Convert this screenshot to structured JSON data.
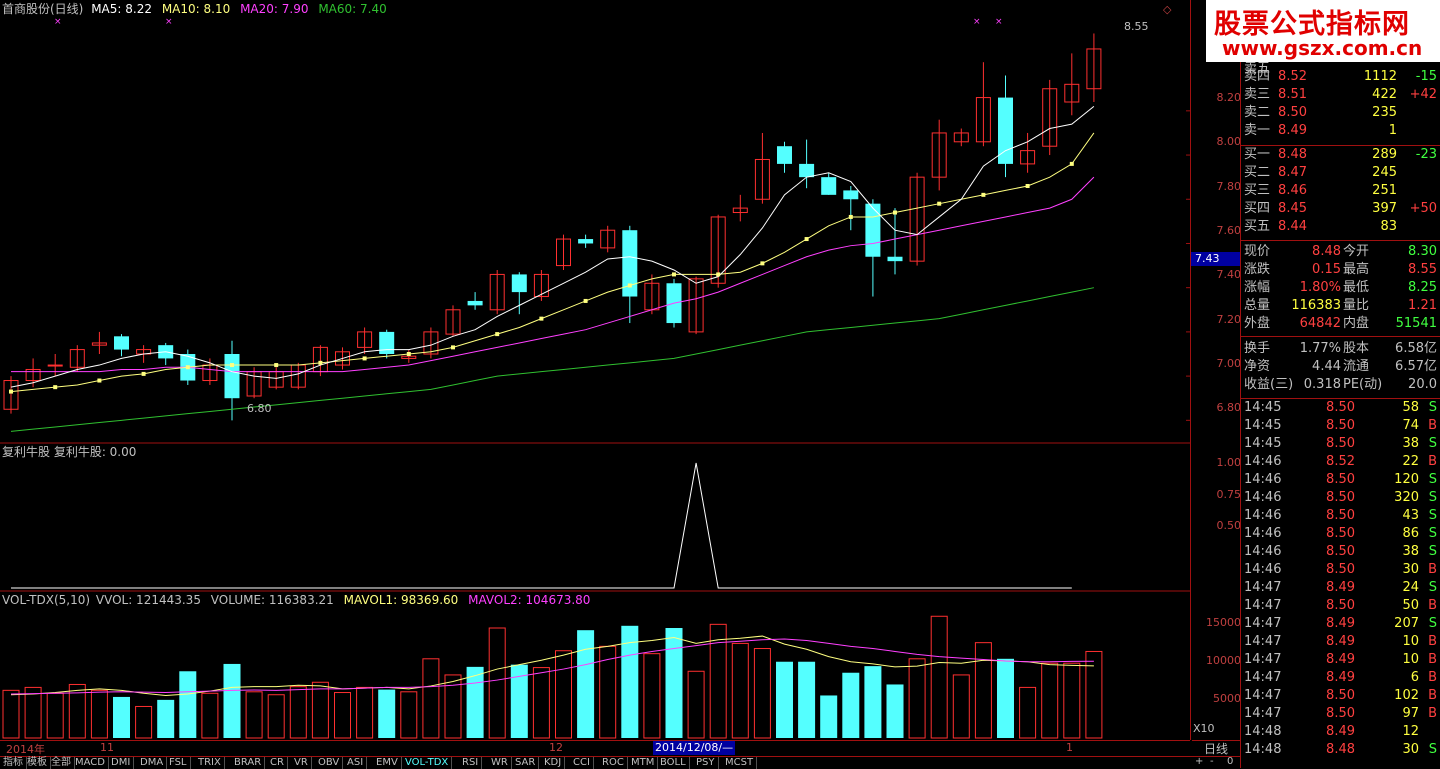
{
  "header": {
    "stock": "首商股份(日线)",
    "ma5": "MA5: 8.22",
    "ma10": "MA10: 8.10",
    "ma20": "MA20: 7.90",
    "ma60": "MA60: 7.40"
  },
  "colors": {
    "up": "#ff3030",
    "down": "#54ffff",
    "ma5": "#ffffff",
    "ma10": "#ffff80",
    "ma20": "#ff40ff",
    "ma60": "#30c030",
    "grid": "#a01010"
  },
  "price_axis": {
    "ticks": [
      "8.20",
      "8.00",
      "7.80",
      "7.60",
      "7.40",
      "7.20",
      "7.00",
      "6.80"
    ],
    "current": "7.43"
  },
  "annotations": {
    "high": "8.55",
    "low": "6.80"
  },
  "indicator": {
    "title": "复利牛股  复利牛股: 0.00",
    "ticks": [
      "1.00",
      "0.75",
      "0.50"
    ],
    "values": [
      0,
      0,
      0,
      0,
      0,
      0,
      0,
      0,
      0,
      0,
      0,
      0,
      0,
      0,
      0,
      0,
      0,
      0,
      0,
      0,
      0,
      0,
      0,
      0,
      0,
      0,
      0,
      0,
      0,
      0,
      0,
      1,
      0,
      0,
      0,
      0,
      0,
      0,
      0,
      0,
      0,
      0,
      0,
      0,
      0,
      0,
      0,
      0,
      0
    ]
  },
  "volume": {
    "title": "VOL-TDX(5,10)",
    "vvol": "VVOL: 121443.35",
    "vol": "VOLUME: 116383.21",
    "mavol1": "MAVOL1: 98369.60",
    "mavol2": "MAVOL2: 104673.80",
    "ticks": [
      "15000",
      "10000",
      "5000"
    ],
    "unit": "X10"
  },
  "time_axis": {
    "labels": [
      "2014年",
      "11",
      "12",
      "1"
    ],
    "cursor": "2014/12/08/—",
    "period": "日线"
  },
  "chart_data": {
    "type": "candlestick",
    "ylim": [
      6.72,
      8.62
    ],
    "vol_ylim": [
      0,
      18000
    ],
    "candles": [
      {
        "o": 6.85,
        "c": 6.98,
        "h": 7.0,
        "l": 6.83,
        "v": 6500
      },
      {
        "o": 6.98,
        "c": 7.03,
        "h": 7.08,
        "l": 6.95,
        "v": 6900
      },
      {
        "o": 7.05,
        "c": 7.05,
        "h": 7.1,
        "l": 7.0,
        "v": 6100
      },
      {
        "o": 7.04,
        "c": 7.12,
        "h": 7.14,
        "l": 7.02,
        "v": 7300
      },
      {
        "o": 7.14,
        "c": 7.15,
        "h": 7.2,
        "l": 7.1,
        "v": 6500
      },
      {
        "o": 7.18,
        "c": 7.12,
        "h": 7.19,
        "l": 7.09,
        "v": 5600
      },
      {
        "o": 7.1,
        "c": 7.12,
        "h": 7.14,
        "l": 7.06,
        "v": 4300
      },
      {
        "o": 7.14,
        "c": 7.08,
        "h": 7.15,
        "l": 7.05,
        "v": 5200
      },
      {
        "o": 7.1,
        "c": 6.98,
        "h": 7.12,
        "l": 6.96,
        "v": 9100
      },
      {
        "o": 6.98,
        "c": 7.05,
        "h": 7.08,
        "l": 6.96,
        "v": 6100
      },
      {
        "o": 7.1,
        "c": 6.9,
        "h": 7.16,
        "l": 6.8,
        "v": 10100
      },
      {
        "o": 6.91,
        "c": 7.02,
        "h": 7.04,
        "l": 6.9,
        "v": 6300
      },
      {
        "o": 6.95,
        "c": 7.02,
        "h": 7.04,
        "l": 6.94,
        "v": 5900
      },
      {
        "o": 6.95,
        "c": 7.05,
        "h": 7.06,
        "l": 6.94,
        "v": 7000
      },
      {
        "o": 7.02,
        "c": 7.13,
        "h": 7.14,
        "l": 7.0,
        "v": 7600
      },
      {
        "o": 7.05,
        "c": 7.11,
        "h": 7.13,
        "l": 7.03,
        "v": 6200
      },
      {
        "o": 7.13,
        "c": 7.2,
        "h": 7.22,
        "l": 7.1,
        "v": 6900
      },
      {
        "o": 7.2,
        "c": 7.1,
        "h": 7.21,
        "l": 7.08,
        "v": 6600
      },
      {
        "o": 7.08,
        "c": 7.09,
        "h": 7.12,
        "l": 7.06,
        "v": 6300
      },
      {
        "o": 7.1,
        "c": 7.2,
        "h": 7.22,
        "l": 7.08,
        "v": 10800
      },
      {
        "o": 7.19,
        "c": 7.3,
        "h": 7.32,
        "l": 7.18,
        "v": 8600
      },
      {
        "o": 7.34,
        "c": 7.32,
        "h": 7.38,
        "l": 7.3,
        "v": 9700
      },
      {
        "o": 7.3,
        "c": 7.46,
        "h": 7.48,
        "l": 7.28,
        "v": 15000
      },
      {
        "o": 7.46,
        "c": 7.38,
        "h": 7.47,
        "l": 7.28,
        "v": 10000
      },
      {
        "o": 7.36,
        "c": 7.46,
        "h": 7.48,
        "l": 7.34,
        "v": 9600
      },
      {
        "o": 7.5,
        "c": 7.62,
        "h": 7.64,
        "l": 7.48,
        "v": 11900
      },
      {
        "o": 7.62,
        "c": 7.6,
        "h": 7.64,
        "l": 7.58,
        "v": 14700
      },
      {
        "o": 7.58,
        "c": 7.66,
        "h": 7.68,
        "l": 7.56,
        "v": 12500
      },
      {
        "o": 7.66,
        "c": 7.36,
        "h": 7.68,
        "l": 7.24,
        "v": 15300
      },
      {
        "o": 7.3,
        "c": 7.42,
        "h": 7.46,
        "l": 7.28,
        "v": 11500
      },
      {
        "o": 7.42,
        "c": 7.24,
        "h": 7.44,
        "l": 7.22,
        "v": 15000
      },
      {
        "o": 7.2,
        "c": 7.44,
        "h": 7.45,
        "l": 7.19,
        "v": 9100
      },
      {
        "o": 7.42,
        "c": 7.72,
        "h": 7.73,
        "l": 7.4,
        "v": 15500
      },
      {
        "o": 7.74,
        "c": 7.76,
        "h": 7.82,
        "l": 7.7,
        "v": 12900
      },
      {
        "o": 7.8,
        "c": 7.98,
        "h": 8.1,
        "l": 7.78,
        "v": 12200
      },
      {
        "o": 8.04,
        "c": 7.96,
        "h": 8.06,
        "l": 7.92,
        "v": 10400
      },
      {
        "o": 7.96,
        "c": 7.9,
        "h": 8.07,
        "l": 7.85,
        "v": 10400
      },
      {
        "o": 7.9,
        "c": 7.82,
        "h": 7.92,
        "l": 7.82,
        "v": 5800
      },
      {
        "o": 7.84,
        "c": 7.8,
        "h": 7.86,
        "l": 7.66,
        "v": 8900
      },
      {
        "o": 7.78,
        "c": 7.54,
        "h": 7.8,
        "l": 7.36,
        "v": 9800
      },
      {
        "o": 7.54,
        "c": 7.52,
        "h": 7.76,
        "l": 7.46,
        "v": 7300
      },
      {
        "o": 7.52,
        "c": 7.9,
        "h": 7.92,
        "l": 7.5,
        "v": 10800
      },
      {
        "o": 7.9,
        "c": 8.1,
        "h": 8.16,
        "l": 7.84,
        "v": 16600
      },
      {
        "o": 8.06,
        "c": 8.1,
        "h": 8.12,
        "l": 8.04,
        "v": 8600
      },
      {
        "o": 8.06,
        "c": 8.26,
        "h": 8.42,
        "l": 8.04,
        "v": 13000
      },
      {
        "o": 8.26,
        "c": 7.96,
        "h": 8.36,
        "l": 7.9,
        "v": 10800
      },
      {
        "o": 7.96,
        "c": 8.02,
        "h": 8.1,
        "l": 7.92,
        "v": 6900
      },
      {
        "o": 8.04,
        "c": 8.3,
        "h": 8.34,
        "l": 8.0,
        "v": 10200
      },
      {
        "o": 8.24,
        "c": 8.32,
        "h": 8.46,
        "l": 8.18,
        "v": 10200
      },
      {
        "o": 8.3,
        "c": 8.48,
        "h": 8.55,
        "l": 8.24,
        "v": 11800
      }
    ],
    "ma5": [
      6.95,
      6.97,
      7.0,
      7.03,
      7.05,
      7.08,
      7.1,
      7.11,
      7.09,
      7.06,
      7.02,
      7.0,
      6.99,
      7.01,
      7.05,
      7.08,
      7.11,
      7.12,
      7.12,
      7.14,
      7.18,
      7.21,
      7.27,
      7.32,
      7.37,
      7.42,
      7.47,
      7.53,
      7.54,
      7.52,
      7.48,
      7.42,
      7.45,
      7.55,
      7.67,
      7.82,
      7.9,
      7.92,
      7.88,
      7.76,
      7.66,
      7.64,
      7.72,
      7.8,
      7.95,
      8.02,
      8.06,
      8.12,
      8.14,
      8.22
    ],
    "ma10": [
      6.93,
      6.94,
      6.95,
      6.96,
      6.98,
      7.0,
      7.01,
      7.03,
      7.04,
      7.05,
      7.05,
      7.05,
      7.05,
      7.05,
      7.06,
      7.07,
      7.08,
      7.09,
      7.1,
      7.11,
      7.13,
      7.16,
      7.19,
      7.22,
      7.26,
      7.3,
      7.34,
      7.38,
      7.41,
      7.44,
      7.46,
      7.46,
      7.46,
      7.47,
      7.51,
      7.56,
      7.62,
      7.68,
      7.72,
      7.72,
      7.74,
      7.76,
      7.78,
      7.8,
      7.82,
      7.84,
      7.86,
      7.9,
      7.96,
      8.1
    ],
    "ma20": [
      7.02,
      7.02,
      7.02,
      7.02,
      7.02,
      7.03,
      7.03,
      7.04,
      7.04,
      7.03,
      7.02,
      7.02,
      7.02,
      7.02,
      7.02,
      7.02,
      7.03,
      7.04,
      7.05,
      7.07,
      7.09,
      7.11,
      7.13,
      7.15,
      7.17,
      7.19,
      7.21,
      7.24,
      7.27,
      7.3,
      7.33,
      7.35,
      7.38,
      7.42,
      7.46,
      7.5,
      7.54,
      7.57,
      7.59,
      7.6,
      7.62,
      7.64,
      7.66,
      7.68,
      7.7,
      7.72,
      7.74,
      7.76,
      7.8,
      7.9
    ],
    "ma60": [
      6.75,
      6.76,
      6.77,
      6.78,
      6.79,
      6.8,
      6.81,
      6.82,
      6.83,
      6.84,
      6.85,
      6.86,
      6.87,
      6.88,
      6.89,
      6.9,
      6.91,
      6.92,
      6.93,
      6.94,
      6.96,
      6.98,
      7.0,
      7.01,
      7.02,
      7.03,
      7.04,
      7.05,
      7.06,
      7.07,
      7.08,
      7.1,
      7.12,
      7.14,
      7.16,
      7.18,
      7.2,
      7.21,
      7.22,
      7.23,
      7.24,
      7.25,
      7.26,
      7.28,
      7.3,
      7.32,
      7.34,
      7.36,
      7.38,
      7.4
    ],
    "mavol1": [
      5900,
      6000,
      6200,
      6500,
      6700,
      6500,
      6100,
      5800,
      6000,
      6400,
      6900,
      7000,
      7000,
      7200,
      7100,
      6700,
      6800,
      6900,
      6700,
      7100,
      7700,
      8500,
      9400,
      10000,
      10600,
      11300,
      12100,
      12500,
      13000,
      13300,
      13700,
      12900,
      13400,
      13600,
      13900,
      12800,
      12100,
      11100,
      10400,
      10100,
      9700,
      9800,
      10300,
      10200,
      10600,
      10500,
      10400,
      10000,
      9900,
      9837
    ],
    "mavol2": [
      6000,
      6050,
      6100,
      6150,
      6250,
      6300,
      6250,
      6200,
      6300,
      6400,
      6500,
      6550,
      6500,
      6600,
      6700,
      6700,
      6800,
      6900,
      6900,
      7000,
      7200,
      7500,
      7900,
      8400,
      8900,
      9400,
      10000,
      10700,
      11300,
      11800,
      12200,
      12600,
      13000,
      13200,
      13400,
      13500,
      13300,
      12900,
      12500,
      12200,
      11800,
      11400,
      11100,
      10900,
      10700,
      10500,
      10400,
      10400,
      10450,
      10467
    ]
  },
  "quote": {
    "sell_partial": "卖五",
    "asks": [
      {
        "label": "卖四",
        "price": "8.52",
        "vol": "1112",
        "chg": "-15"
      },
      {
        "label": "卖三",
        "price": "8.51",
        "vol": "422",
        "chg": "+42"
      },
      {
        "label": "卖二",
        "price": "8.50",
        "vol": "235",
        "chg": ""
      },
      {
        "label": "卖一",
        "price": "8.49",
        "vol": "1",
        "chg": ""
      }
    ],
    "bids": [
      {
        "label": "买一",
        "price": "8.48",
        "vol": "289",
        "chg": "-23"
      },
      {
        "label": "买二",
        "price": "8.47",
        "vol": "245",
        "chg": ""
      },
      {
        "label": "买三",
        "price": "8.46",
        "vol": "251",
        "chg": ""
      },
      {
        "label": "买四",
        "price": "8.45",
        "vol": "397",
        "chg": "+50"
      },
      {
        "label": "买五",
        "price": "8.44",
        "vol": "83",
        "chg": ""
      }
    ],
    "stats": [
      {
        "l1": "现价",
        "v1": "8.48",
        "l2": "今开",
        "v2": "8.30",
        "c1": "#ff4040",
        "c2": "#40ff40"
      },
      {
        "l1": "涨跌",
        "v1": "0.15",
        "l2": "最高",
        "v2": "8.55",
        "c1": "#ff4040",
        "c2": "#ff4040"
      },
      {
        "l1": "涨幅",
        "v1": "1.80%",
        "l2": "最低",
        "v2": "8.25",
        "c1": "#ff4040",
        "c2": "#40ff40"
      },
      {
        "l1": "总量",
        "v1": "116383",
        "l2": "量比",
        "v2": "1.21",
        "c1": "#ffff40",
        "c2": "#ff4040"
      },
      {
        "l1": "外盘",
        "v1": "64842",
        "l2": "内盘",
        "v2": "51541",
        "c1": "#ff4040",
        "c2": "#40ff40"
      }
    ],
    "stats2": [
      {
        "l1": "换手",
        "v1": "1.77%",
        "l2": "股本",
        "v2": "6.58亿"
      },
      {
        "l1": "净资",
        "v1": "4.44",
        "l2": "流通",
        "v2": "6.57亿"
      },
      {
        "l1": "收益(三)",
        "v1": "0.318",
        "l2": "PE(动)",
        "v2": "20.0"
      }
    ],
    "ticks": [
      {
        "t": "14:45",
        "p": "8.50",
        "v": "58",
        "s": "S"
      },
      {
        "t": "14:45",
        "p": "8.50",
        "v": "74",
        "s": "B"
      },
      {
        "t": "14:45",
        "p": "8.50",
        "v": "38",
        "s": "S"
      },
      {
        "t": "14:46",
        "p": "8.52",
        "v": "22",
        "s": "B"
      },
      {
        "t": "14:46",
        "p": "8.50",
        "v": "120",
        "s": "S"
      },
      {
        "t": "14:46",
        "p": "8.50",
        "v": "320",
        "s": "S"
      },
      {
        "t": "14:46",
        "p": "8.50",
        "v": "43",
        "s": "S"
      },
      {
        "t": "14:46",
        "p": "8.50",
        "v": "86",
        "s": "S"
      },
      {
        "t": "14:46",
        "p": "8.50",
        "v": "38",
        "s": "S"
      },
      {
        "t": "14:46",
        "p": "8.50",
        "v": "30",
        "s": "B"
      },
      {
        "t": "14:47",
        "p": "8.49",
        "v": "24",
        "s": "S"
      },
      {
        "t": "14:47",
        "p": "8.50",
        "v": "50",
        "s": "B"
      },
      {
        "t": "14:47",
        "p": "8.49",
        "v": "207",
        "s": "S"
      },
      {
        "t": "14:47",
        "p": "8.49",
        "v": "10",
        "s": "B"
      },
      {
        "t": "14:47",
        "p": "8.49",
        "v": "10",
        "s": "B"
      },
      {
        "t": "14:47",
        "p": "8.49",
        "v": "6",
        "s": "B"
      },
      {
        "t": "14:47",
        "p": "8.50",
        "v": "102",
        "s": "B"
      },
      {
        "t": "14:47",
        "p": "8.50",
        "v": "97",
        "s": "B"
      },
      {
        "t": "14:48",
        "p": "8.49",
        "v": "12",
        "s": ""
      },
      {
        "t": "14:48",
        "p": "8.48",
        "v": "30",
        "s": "S"
      }
    ]
  },
  "brand": {
    "line1": "股票公式指标网",
    "line2": "www.gszx.com.cn"
  },
  "tabs": [
    "指标",
    "模板",
    "全部",
    "MACD",
    "DMI",
    "DMA",
    "FSL",
    "TRIX",
    "BRAR",
    "CR",
    "VR",
    "OBV",
    "ASI",
    "EMV",
    "VOL-TDX",
    "RSI",
    "WR",
    "SAR",
    "KDJ",
    "CCI",
    "ROC",
    "MTM",
    "BOLL",
    "PSY",
    "MCST"
  ],
  "scroll": {
    "plus": "+",
    "minus": "-",
    "zero": "0"
  }
}
